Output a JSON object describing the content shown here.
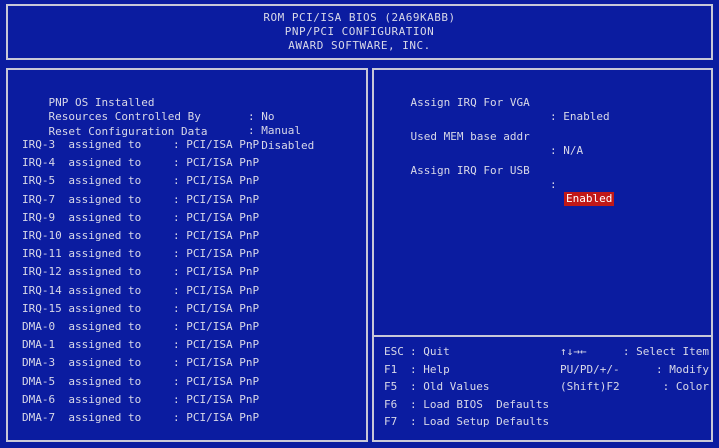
{
  "header": {
    "line1": "ROM PCI/ISA BIOS (2A69KABB)",
    "line2": "PNP/PCI CONFIGURATION",
    "line3": "AWARD SOFTWARE, INC."
  },
  "left": {
    "settings": [
      {
        "label": "PNP OS Installed",
        "value": ": No"
      },
      {
        "label": "Resources Controlled By",
        "value": ": Manual"
      },
      {
        "label": "Reset Configuration Data",
        "value": ": Disabled"
      }
    ],
    "assignments": [
      {
        "label": "IRQ-3  assigned to",
        "value": ": PCI/ISA PnP"
      },
      {
        "label": "IRQ-4  assigned to",
        "value": ": PCI/ISA PnP"
      },
      {
        "label": "IRQ-5  assigned to",
        "value": ": PCI/ISA PnP"
      },
      {
        "label": "IRQ-7  assigned to",
        "value": ": PCI/ISA PnP"
      },
      {
        "label": "IRQ-9  assigned to",
        "value": ": PCI/ISA PnP"
      },
      {
        "label": "IRQ-10 assigned to",
        "value": ": PCI/ISA PnP"
      },
      {
        "label": "IRQ-11 assigned to",
        "value": ": PCI/ISA PnP"
      },
      {
        "label": "IRQ-12 assigned to",
        "value": ": PCI/ISA PnP"
      },
      {
        "label": "IRQ-14 assigned to",
        "value": ": PCI/ISA PnP"
      },
      {
        "label": "IRQ-15 assigned to",
        "value": ": PCI/ISA PnP"
      },
      {
        "label": "DMA-0  assigned to",
        "value": ": PCI/ISA PnP"
      },
      {
        "label": "DMA-1  assigned to",
        "value": ": PCI/ISA PnP"
      },
      {
        "label": "DMA-3  assigned to",
        "value": ": PCI/ISA PnP"
      },
      {
        "label": "DMA-5  assigned to",
        "value": ": PCI/ISA PnP"
      },
      {
        "label": "DMA-6  assigned to",
        "value": ": PCI/ISA PnP"
      },
      {
        "label": "DMA-7  assigned to",
        "value": ": PCI/ISA PnP"
      }
    ]
  },
  "right": {
    "settings": [
      {
        "label": "Assign IRQ For VGA",
        "value": ": Enabled"
      },
      {
        "label": "Used MEM base addr",
        "value": ": N/A"
      },
      {
        "label": "Assign IRQ For USB",
        "colon": ":",
        "value": "Enabled"
      }
    ]
  },
  "help": [
    {
      "key": "ESC",
      "action": ": Quit",
      "key2": "↑↓→←",
      "action2": ": Select Item"
    },
    {
      "key": "F1",
      "action": ": Help",
      "key2": "PU/PD/+/-",
      "action2": ": Modify"
    },
    {
      "key": "F5",
      "action": ": Old Values",
      "key2": "(Shift)F2",
      "action2": ": Color"
    },
    {
      "key": "F6",
      "action": ": Load BIOS  Defaults",
      "key2": "",
      "action2": ""
    },
    {
      "key": "F7",
      "action": ": Load Setup Defaults",
      "key2": "",
      "action2": ""
    }
  ],
  "colors": {
    "background": "#0b1ca0",
    "text": "#d8d8e8",
    "highlight": "#c01818"
  }
}
